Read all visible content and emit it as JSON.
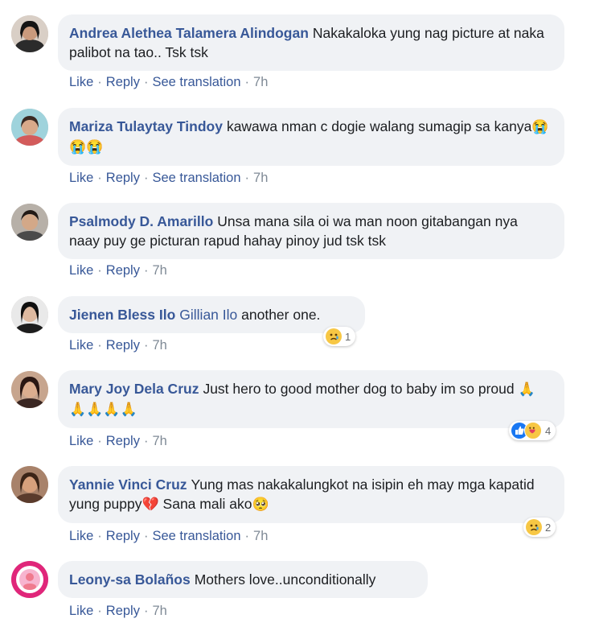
{
  "labels": {
    "like": "Like",
    "reply": "Reply",
    "see_translation": "See translation"
  },
  "comments": [
    {
      "author": "Andrea Alethea Talamera Alindogan",
      "text": "Nakakaloka yung nag picture at naka palibot na tao.. Tsk tsk",
      "time": "7h"
    },
    {
      "author": "Mariza Tulaytay Tindoy",
      "text": "kawawa nman c dogie walang sumagip sa kanya",
      "emoji": "😭😭😭",
      "time": "7h"
    },
    {
      "author": "Psalmody D. Amarillo",
      "text": "Unsa mana sila oi wa man noon gitabangan nya naay puy ge picturan rapud hahay pinoy jud tsk tsk",
      "time": "7h"
    },
    {
      "author": "Jienen Bless Ilo",
      "mention": "Gillian Ilo",
      "text": "another one.",
      "time": "7h",
      "reaction_count": "1"
    },
    {
      "author": "Mary Joy Dela Cruz",
      "text": "Just hero to good mother dog to baby im so proud",
      "emoji": "🙏🙏🙏🙏🙏",
      "time": "7h",
      "reaction_count": "4"
    },
    {
      "author": "Yannie Vinci Cruz",
      "text_a": "Yung mas nakakalungkot na isipin eh may mga kapatid yung puppy",
      "emoji_a": "💔",
      "text_b": "Sana mali ako",
      "emoji_b": "🥺",
      "time": "7h",
      "reaction_count": "2"
    },
    {
      "author": "Leony-sa Bolaños",
      "text": "Mothers love..unconditionally",
      "time": "7h"
    }
  ],
  "colors": {
    "link": "#385898",
    "bubble": "#f0f2f5",
    "meta": "#7f8a96"
  }
}
